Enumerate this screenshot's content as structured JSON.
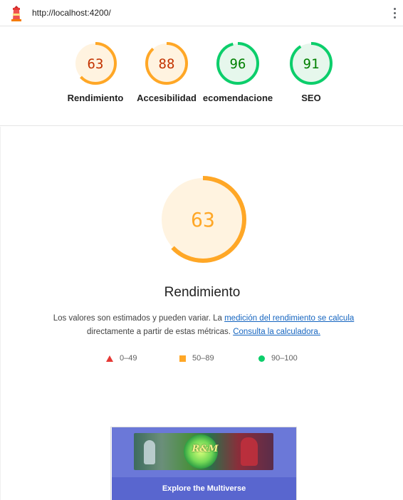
{
  "header": {
    "url": "http://localhost:4200/",
    "menu_icon": "kebab-menu-icon",
    "logo_icon": "lighthouse-icon"
  },
  "scores": [
    {
      "value": "63",
      "label": "Rendimiento",
      "score": 63,
      "color": "#ffa726",
      "text_color": "#c33300",
      "bg": "#fff3e0"
    },
    {
      "value": "88",
      "label": "Accesibilidad",
      "score": 88,
      "color": "#ffa726",
      "text_color": "#c33300",
      "bg": "#fff3e0"
    },
    {
      "value": "96",
      "label": "ecomendacione",
      "score": 96,
      "color": "#0cce6b",
      "text_color": "#008000",
      "bg": "#e6f7ec"
    },
    {
      "value": "91",
      "label": "SEO",
      "score": 91,
      "color": "#0cce6b",
      "text_color": "#008000",
      "bg": "#e6f7ec"
    }
  ],
  "main": {
    "score": {
      "value": "63",
      "score": 63,
      "color": "#ffa726",
      "text_color": "#ffa726",
      "bg": "#fff3e0"
    },
    "title": "Rendimiento",
    "desc_pre": "Los valores son estimados y pueden variar. La ",
    "desc_link1": "medición del rendimiento se calcula",
    "desc_mid": " directamente a partir de estas métricas. ",
    "desc_link2": "Consulta la calculadora."
  },
  "legend": [
    {
      "range": "0–49",
      "shape": "triangle",
      "color": "#e53935"
    },
    {
      "range": "50–89",
      "shape": "square",
      "color": "#ffa726"
    },
    {
      "range": "90–100",
      "shape": "circle",
      "color": "#0cce6b"
    }
  ],
  "card": {
    "logo_text": "Rick and Morty",
    "cta": "Explore the Multiverse"
  }
}
